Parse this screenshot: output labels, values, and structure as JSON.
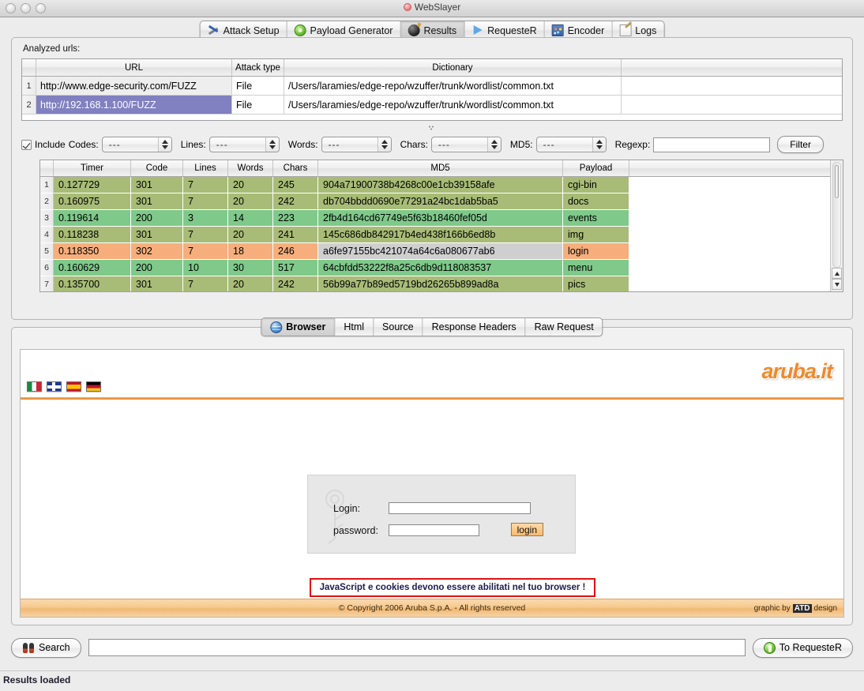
{
  "window": {
    "title": "WebSlayer",
    "traffic_lights": [
      "close",
      "minimize",
      "zoom"
    ]
  },
  "main_tabs": [
    {
      "label": "Attack Setup",
      "icon": "wrench-icon",
      "active": false
    },
    {
      "label": "Payload Generator",
      "icon": "gear-icon",
      "active": false
    },
    {
      "label": "Results",
      "icon": "bomb-icon",
      "active": true
    },
    {
      "label": "RequesteR",
      "icon": "play-icon",
      "active": false
    },
    {
      "label": "Encoder",
      "icon": "encoder-icon",
      "active": false
    },
    {
      "label": "Logs",
      "icon": "logs-icon",
      "active": false
    }
  ],
  "urls_section": {
    "label": "Analyzed urls:",
    "columns": [
      "",
      "URL",
      "Attack type",
      "Dictionary"
    ],
    "rows": [
      {
        "index": "1",
        "url": "http://www.edge-security.com/FUZZ",
        "attack_type": "File",
        "dictionary": "/Users/laramies/edge-repo/wzuffer/trunk/wordlist/common.txt",
        "selected": false
      },
      {
        "index": "2",
        "url": "http://192.168.1.100/FUZZ",
        "attack_type": "File",
        "dictionary": "/Users/laramies/edge-repo/wzuffer/trunk/wordlist/common.txt",
        "selected": true
      }
    ]
  },
  "filter_bar": {
    "include_label": "Include",
    "include_checked": true,
    "fields": [
      {
        "label": "Codes:",
        "value": "---"
      },
      {
        "label": "Lines:",
        "value": "---"
      },
      {
        "label": "Words:",
        "value": "---"
      },
      {
        "label": "Chars:",
        "value": "---"
      },
      {
        "label": "MD5:",
        "value": "---"
      }
    ],
    "regexp_label": "Regexp:",
    "regexp_value": "",
    "filter_button": "Filter"
  },
  "results_table": {
    "columns": [
      "",
      "Timer",
      "Code",
      "Lines",
      "Words",
      "Chars",
      "MD5",
      "Payload"
    ],
    "rows": [
      {
        "index": "1",
        "timer": "0.127729",
        "code": "301",
        "lines": "7",
        "words": "20",
        "chars": "245",
        "md5": "904a71900738b4268c00e1cb39158afe",
        "payload": "cgi-bin",
        "color": "#a8bc77"
      },
      {
        "index": "2",
        "timer": "0.160975",
        "code": "301",
        "lines": "7",
        "words": "20",
        "chars": "242",
        "md5": "db704bbdd0690e77291a24bc1dab5ba5",
        "payload": "docs",
        "color": "#a8bc77"
      },
      {
        "index": "3",
        "timer": "0.119614",
        "code": "200",
        "lines": "3",
        "words": "14",
        "chars": "223",
        "md5": "2fb4d164cd67749e5f63b18460fef05d",
        "payload": "events",
        "color": "#7fc98a"
      },
      {
        "index": "4",
        "timer": "0.118238",
        "code": "301",
        "lines": "7",
        "words": "20",
        "chars": "241",
        "md5": "145c686db842917b4ed438f166b6ed8b",
        "payload": "img",
        "color": "#a8bc77"
      },
      {
        "index": "5",
        "timer": "0.118350",
        "code": "302",
        "lines": "7",
        "words": "18",
        "chars": "246",
        "md5": "a6fe97155bc421074a64c6a080677ab6",
        "payload": "login",
        "color": "#f5ae7c",
        "md5_selected": true
      },
      {
        "index": "6",
        "timer": "0.160629",
        "code": "200",
        "lines": "10",
        "words": "30",
        "chars": "517",
        "md5": "64cbfdd53222f8a25c6db9d118083537",
        "payload": "menu",
        "color": "#7fc98a"
      },
      {
        "index": "7",
        "timer": "0.135700",
        "code": "301",
        "lines": "7",
        "words": "20",
        "chars": "242",
        "md5": "56b99a77b89ed5719bd26265b899ad8a",
        "payload": "pics",
        "color": "#a8bc77"
      }
    ]
  },
  "preview_tabs": [
    {
      "label": "Browser",
      "icon": "globe-icon",
      "active": true
    },
    {
      "label": "Html",
      "active": false
    },
    {
      "label": "Source",
      "active": false
    },
    {
      "label": "Response Headers",
      "active": false
    },
    {
      "label": "Raw Request",
      "active": false
    }
  ],
  "browser_page": {
    "logo": "aruba.it",
    "flags": [
      "italy-flag",
      "uk-flag",
      "spain-flag",
      "germany-flag"
    ],
    "login_form": {
      "login_label": "Login:",
      "login_value": "",
      "password_label": "password:",
      "password_value": "",
      "submit_label": "login"
    },
    "warning": "JavaScript e cookies devono essere abilitati nel tuo browser !",
    "footer_copyright": "© Copyright 2006 Aruba S.p.A. - All rights reserved",
    "footer_credit_prefix": "graphic by",
    "footer_credit_brand": "ATD",
    "footer_credit_suffix": "design"
  },
  "search_bar": {
    "search_label": "Search",
    "search_value": "",
    "to_requester_label": "To RequesteR"
  },
  "status_bar": {
    "text": "Results loaded"
  },
  "colors": {
    "selected_row": "#8180c0",
    "redirect_olive": "#a8bc77",
    "ok_green": "#7fc98a",
    "found_orange": "#f5ae7c",
    "warning_border": "#e01010",
    "aruba_orange": "#f08a2a"
  }
}
